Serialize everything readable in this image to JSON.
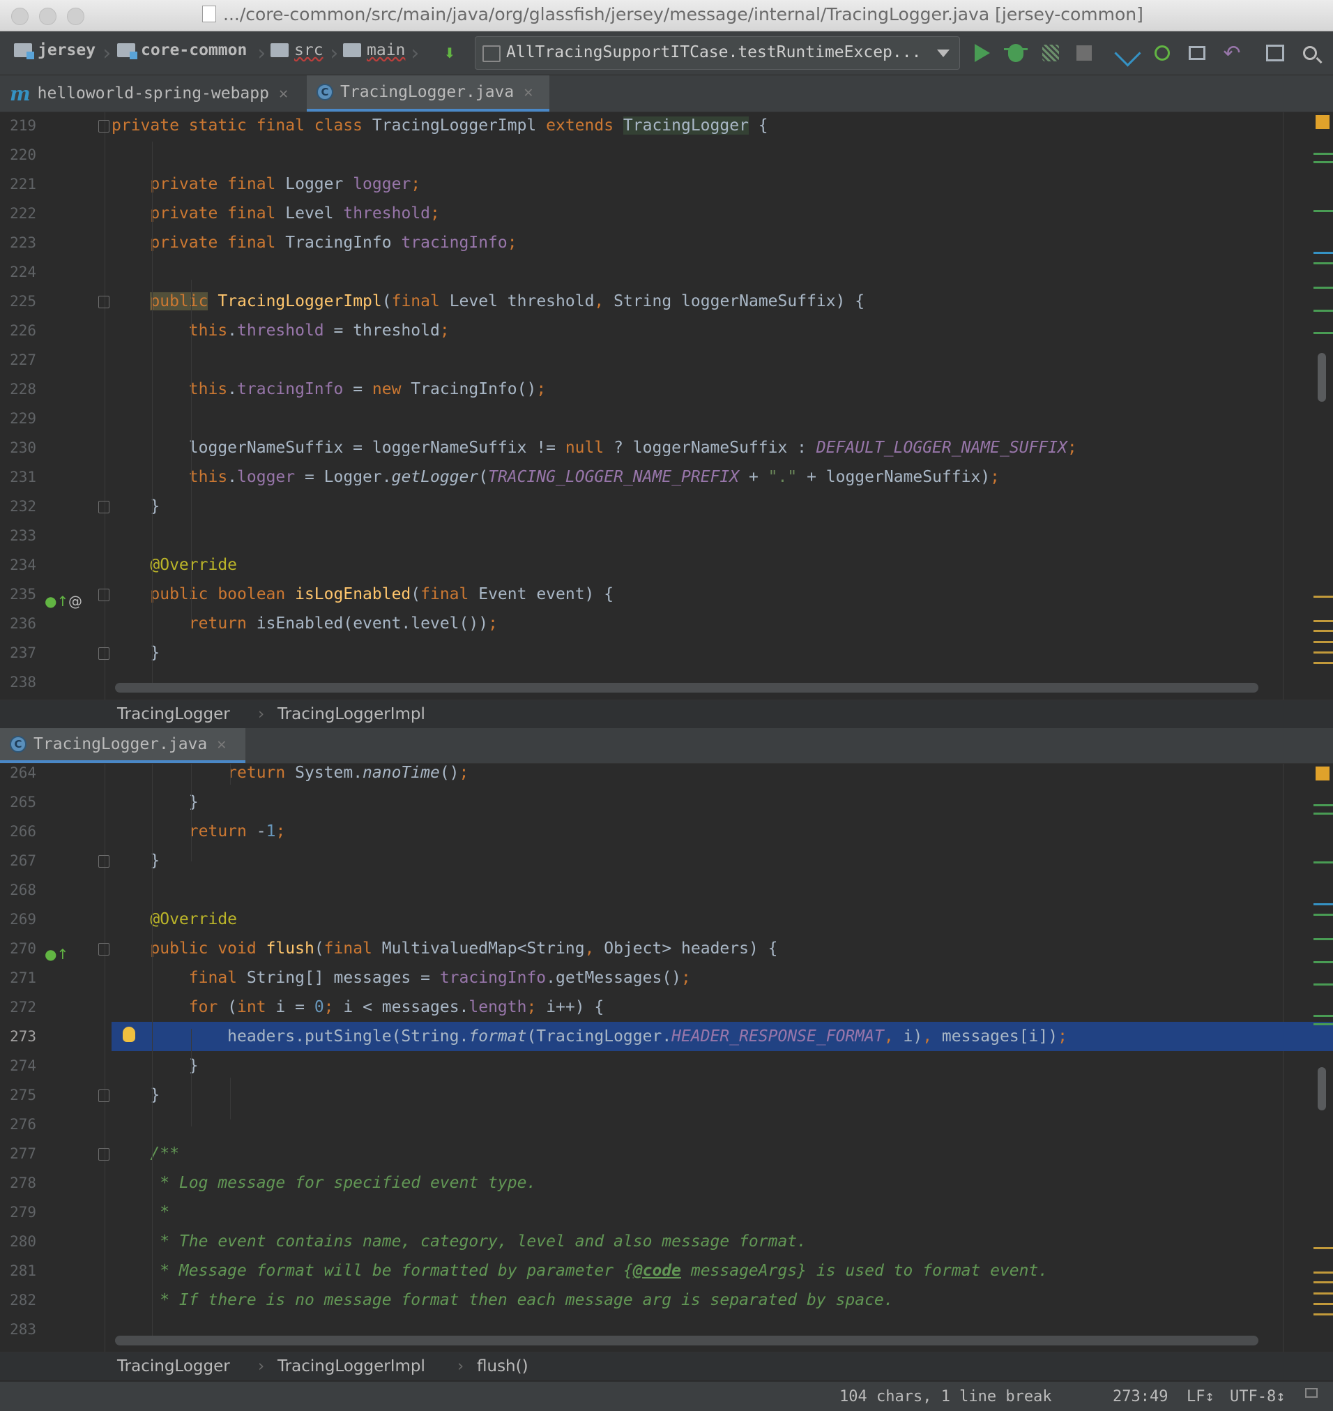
{
  "window": {
    "title": ".../core-common/src/main/java/org/glassfish/jersey/message/internal/TracingLogger.java [jersey-common]"
  },
  "navbar": {
    "breadcrumbs": [
      "jersey",
      "core-common",
      "src",
      "main"
    ],
    "run_config": "AllTracingSupportITCase.testRuntimeExcep..."
  },
  "top_tabs": [
    {
      "label": "helloworld-spring-webapp",
      "icon": "maven-module-icon"
    },
    {
      "label": "TracingLogger.java",
      "icon": "java-class-icon"
    }
  ],
  "top_editor": {
    "lines": [
      {
        "n": "219",
        "html": "<span class=\"k\">private static final class </span>TracingLoggerImpl <span class=\"k\">extends </span><span class=\"hl\">TracingLogger</span> {"
      },
      {
        "n": "220",
        "html": ""
      },
      {
        "n": "221",
        "html": "    <span class=\"k\">private final </span>Logger <span class=\"f\">logger</span><span class=\"k\">;</span>"
      },
      {
        "n": "222",
        "html": "    <span class=\"k\">private final </span>Level <span class=\"f\">threshold</span><span class=\"k\">;</span>"
      },
      {
        "n": "223",
        "html": "    <span class=\"k\">private final </span>TracingInfo <span class=\"f\">tracingInfo</span><span class=\"k\">;</span>"
      },
      {
        "n": "224",
        "html": ""
      },
      {
        "n": "225",
        "html": "    <span class=\"k hl2\">public</span> <span class=\"m\">TracingLoggerImpl</span>(<span class=\"k\">final </span>Level threshold<span class=\"k\">, </span>String loggerNameSuffix) {"
      },
      {
        "n": "226",
        "html": "        <span class=\"k\">this</span>.<span class=\"f\">threshold</span> = threshold<span class=\"k\">;</span>"
      },
      {
        "n": "227",
        "html": ""
      },
      {
        "n": "228",
        "html": "        <span class=\"k\">this</span>.<span class=\"f\">tracingInfo</span> = <span class=\"k\">new </span>TracingInfo()<span class=\"k\">;</span>"
      },
      {
        "n": "229",
        "html": ""
      },
      {
        "n": "230",
        "html": "        loggerNameSuffix = loggerNameSuffix != <span class=\"k\">null </span>? loggerNameSuffix : <span class=\"st\">DEFAULT_LOGGER_NAME_SUFFIX</span><span class=\"k\">;</span>"
      },
      {
        "n": "231",
        "html": "        <span class=\"k\">this</span>.<span class=\"f\">logger</span> = Logger.<span class=\"it\">getLogger</span>(<span class=\"st\">TRACING_LOGGER_NAME_PREFIX</span> + <span class=\"s\">\".\"</span> + loggerNameSuffix)<span class=\"k\">;</span>"
      },
      {
        "n": "232",
        "html": "    }"
      },
      {
        "n": "233",
        "html": ""
      },
      {
        "n": "234",
        "html": "    <span class=\"a\">@Override</span>"
      },
      {
        "n": "235",
        "html": "    <span class=\"k\">public boolean </span><span class=\"m\">isLogEnabled</span>(<span class=\"k\">final </span>Event event) {"
      },
      {
        "n": "236",
        "html": "        <span class=\"k\">return </span>isEnabled(event.level())<span class=\"k\">;</span>"
      },
      {
        "n": "237",
        "html": "    }"
      },
      {
        "n": "238",
        "html": ""
      }
    ]
  },
  "top_breadcrumb": [
    "TracingLogger",
    "TracingLoggerImpl"
  ],
  "bottom_tabs": [
    {
      "label": "TracingLogger.java",
      "icon": "java-class-icon"
    }
  ],
  "bottom_editor": {
    "lines": [
      {
        "n": "264",
        "html": "            <span class=\"k\">return </span>System.<span class=\"it\">nanoTime</span>()<span class=\"k\">;</span>"
      },
      {
        "n": "265",
        "html": "        }"
      },
      {
        "n": "266",
        "html": "        <span class=\"k\">return </span>-<span class=\"n\">1</span><span class=\"k\">;</span>"
      },
      {
        "n": "267",
        "html": "    }"
      },
      {
        "n": "268",
        "html": ""
      },
      {
        "n": "269",
        "html": "    <span class=\"a\">@Override</span>"
      },
      {
        "n": "270",
        "html": "    <span class=\"k\">public void </span><span class=\"m\">flush</span>(<span class=\"k\">final </span>MultivaluedMap&lt;String<span class=\"k\">, </span>Object&gt; headers) {"
      },
      {
        "n": "271",
        "html": "        <span class=\"k\">final </span>String[] messages = <span class=\"f\">tracingInfo</span>.getMessages()<span class=\"k\">;</span>"
      },
      {
        "n": "272",
        "html": "        <span class=\"k\">for </span>(<span class=\"k\">int </span>i = <span class=\"n\">0</span><span class=\"k\">; </span>i &lt; messages.<span class=\"f\">length</span><span class=\"k\">; </span>i++) {"
      },
      {
        "n": "273",
        "html": "            headers.putSingle(String.<span class=\"it\">format</span>(TracingLogger.<span class=\"st\">HEADER_RESPONSE_FORMAT</span><span class=\"k\">, </span>i)<span class=\"k\">, </span>messages[i])<span class=\"k\">;</span>"
      },
      {
        "n": "274",
        "html": "        }"
      },
      {
        "n": "275",
        "html": "    }"
      },
      {
        "n": "276",
        "html": ""
      },
      {
        "n": "277",
        "html": "    <span class=\"c\">/**</span>"
      },
      {
        "n": "278",
        "html": "<span class=\"c\">     * Log message for specified event type.</span>"
      },
      {
        "n": "279",
        "html": "<span class=\"c\">     *</span>"
      },
      {
        "n": "280",
        "html": "<span class=\"c\">     * The event contains name, category, level and also message format.</span>"
      },
      {
        "n": "281",
        "html": "<span class=\"c\">     * Message format will be formatted by parameter {</span><span class=\"ct\">@code</span><span class=\"c\"> messageArgs} is used to format event.</span>"
      },
      {
        "n": "282",
        "html": "<span class=\"c\">     * If there is no message format then each message arg is separated by space.</span>"
      },
      {
        "n": "283",
        "html": ""
      }
    ]
  },
  "bottom_breadcrumb": [
    "TracingLogger",
    "TracingLoggerImpl",
    "flush()"
  ],
  "status": {
    "selection": "104 chars, 1 line break",
    "position": "273:49",
    "line_sep": "LF↕",
    "encoding": "UTF-8↕"
  },
  "colors": {
    "editor_bg": "#2b2b2b",
    "selection": "#214283",
    "keyword": "#cc7832",
    "field": "#9876aa",
    "method": "#ffc66d",
    "annotation": "#bbb529",
    "string": "#6a8759",
    "number": "#6897bb",
    "doc_comment": "#629755"
  }
}
